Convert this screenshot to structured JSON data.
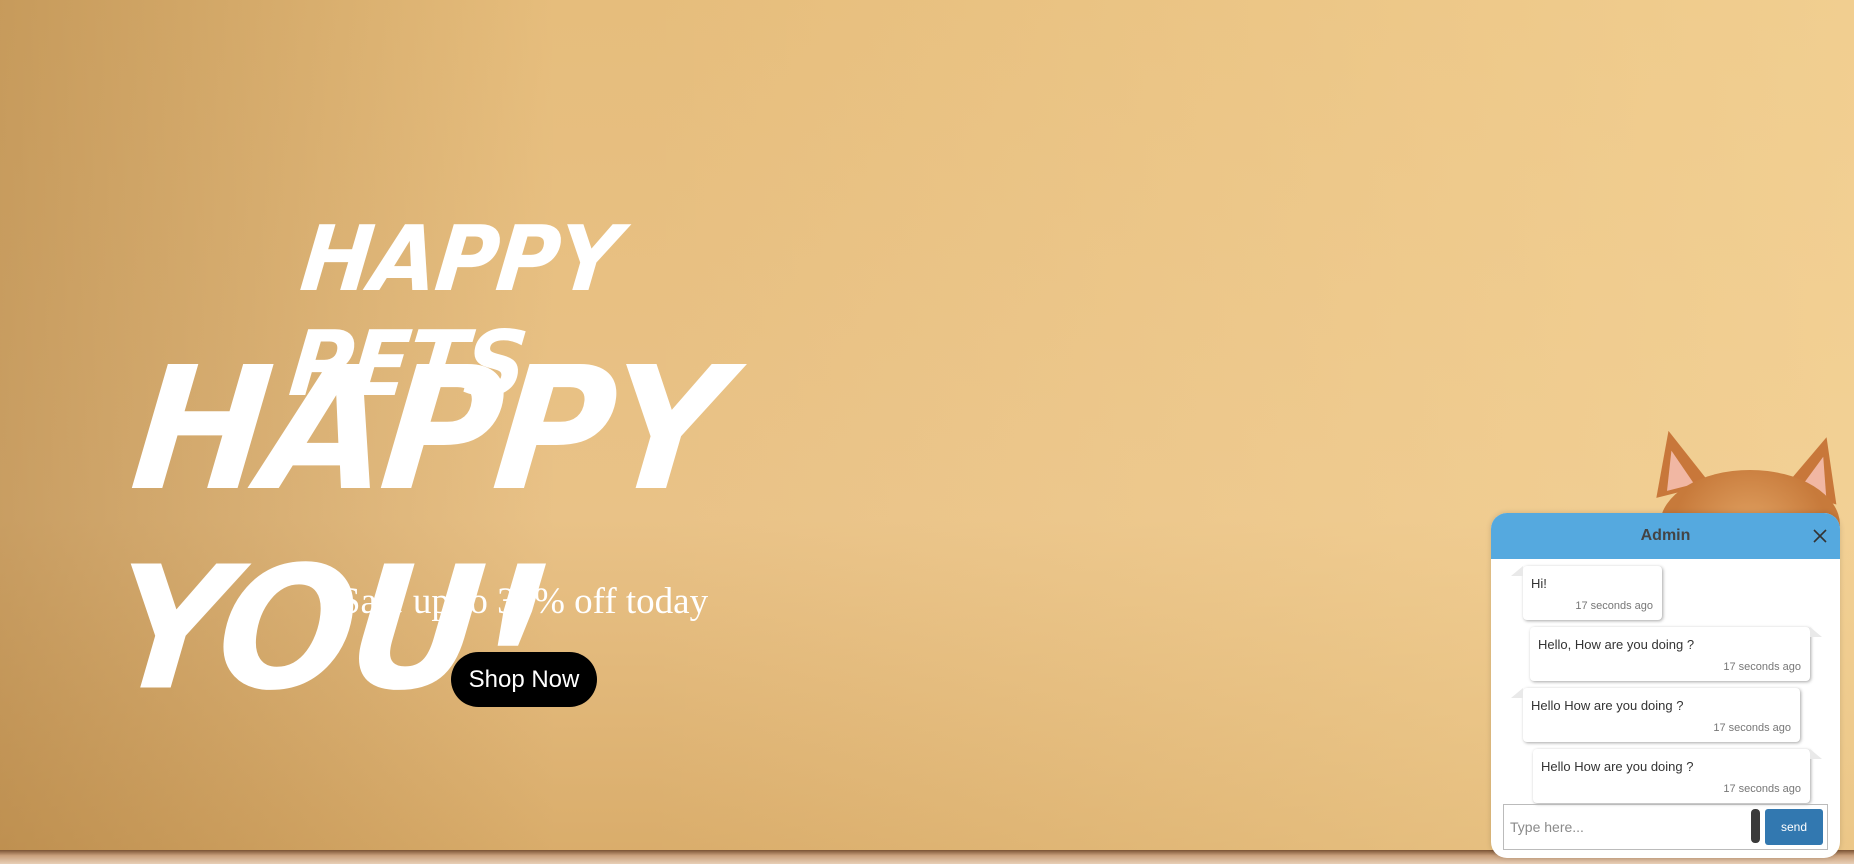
{
  "hero": {
    "headline_line1": "HAPPY PETS,",
    "headline_line2": "HAPPY YOU!",
    "subtitle": "Sale up to 30% off today",
    "cta_label": "Shop Now"
  },
  "chat": {
    "title": "Admin",
    "close_icon": "close-icon",
    "messages": [
      {
        "text": "Hi!",
        "time": "17 seconds ago",
        "side": "left"
      },
      {
        "text": "Hello, How are you doing ?",
        "time": "17 seconds ago",
        "side": "right"
      },
      {
        "text": "Hello How are you doing ?",
        "time": "17 seconds ago",
        "side": "left"
      },
      {
        "text": "Hello How are you doing ?",
        "time": "17 seconds ago",
        "side": "right"
      }
    ],
    "input_placeholder": "Type here...",
    "send_label": "send",
    "colors": {
      "header": "#55a9df",
      "send_button": "#3278b0"
    }
  }
}
